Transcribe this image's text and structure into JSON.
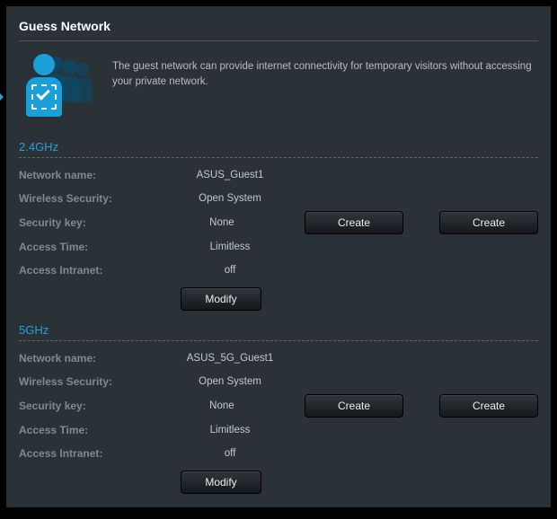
{
  "title": "Guess Network",
  "intro": "The guest network can provide internet connectivity for temporary visitors without accessing your private network.",
  "labels": {
    "network_name": "Network name:",
    "wireless_security": "Wireless Security:",
    "security_key": "Security key:",
    "access_time": "Access Time:",
    "access_intranet": "Access Intranet:"
  },
  "buttons": {
    "create": "Create",
    "modify": "Modify"
  },
  "bands": [
    {
      "title": "2.4GHz",
      "network_name": "ASUS_Guest1",
      "wireless_security": "Open System",
      "security_key": "None",
      "access_time": "Limitless",
      "access_intranet": "off"
    },
    {
      "title": "5GHz",
      "network_name": "ASUS_5G_Guest1",
      "wireless_security": "Open System",
      "security_key": "None",
      "access_time": "Limitless",
      "access_intranet": "off"
    }
  ]
}
